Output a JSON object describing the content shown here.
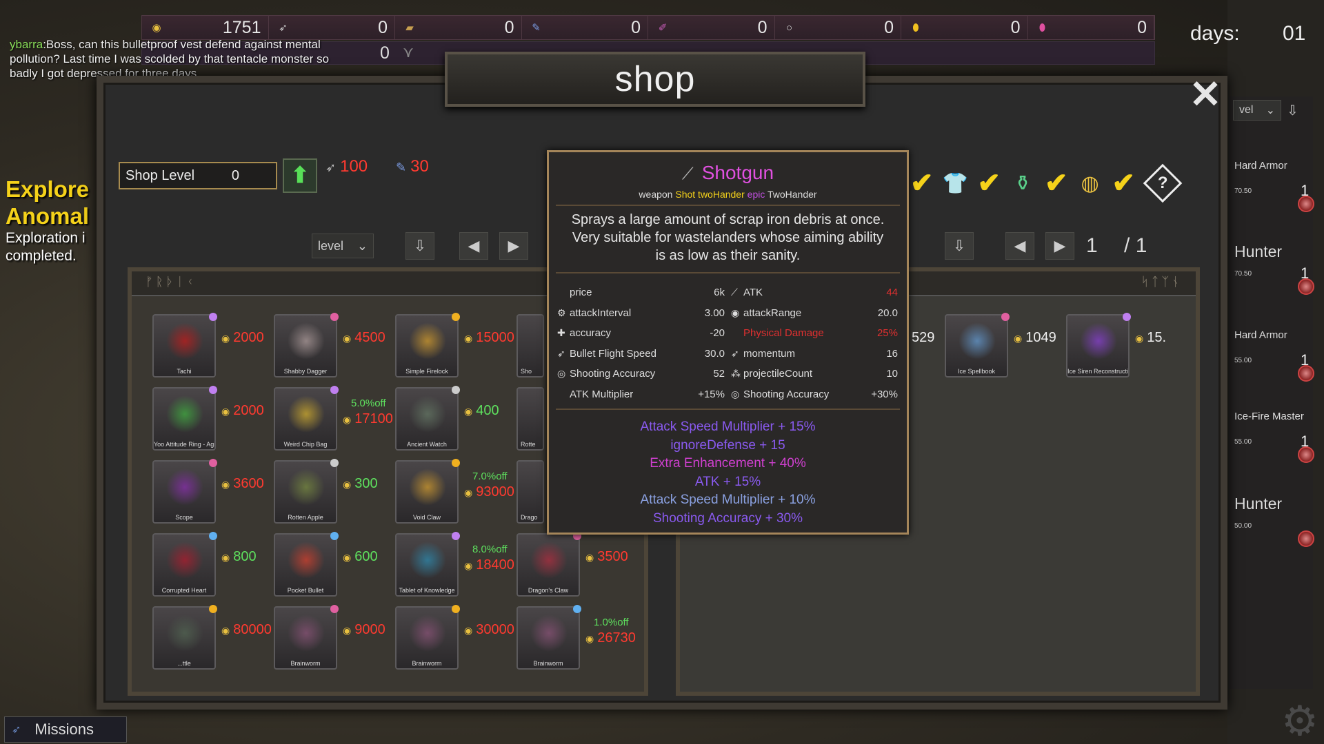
{
  "resources": [
    {
      "icon": "gold-coin-icon",
      "glyph": "◉",
      "color": "#e8c040",
      "value": "1751"
    },
    {
      "icon": "feather-icon",
      "glyph": "➶",
      "color": "#cccccc",
      "value": "0"
    },
    {
      "icon": "wood-icon",
      "glyph": "▰",
      "color": "#c8a050",
      "value": "0"
    },
    {
      "icon": "quill-icon",
      "glyph": "✎",
      "color": "#7a9ae0",
      "value": "0"
    },
    {
      "icon": "tentacle-icon",
      "glyph": "✐",
      "color": "#d060c0",
      "value": "0"
    },
    {
      "icon": "ring-icon",
      "glyph": "○",
      "color": "#dddddd",
      "value": "0"
    },
    {
      "icon": "amber-icon",
      "glyph": "⬮",
      "color": "#f0c020",
      "value": "0"
    },
    {
      "icon": "pink-gem-icon",
      "glyph": "⬮",
      "color": "#e050a0",
      "value": "0"
    }
  ],
  "resource_row2": {
    "value": "0"
  },
  "days": {
    "label": "days:",
    "value": "01"
  },
  "chat": {
    "speaker": "ybarra",
    "message": "Boss, can this bulletproof vest defend against mental pollution? Last time I was scolded by that tentacle monster so badly I got depressed for three days."
  },
  "quest": {
    "title_line1": "Explore",
    "title_line2": "Anomal",
    "desc_line1": "Exploration i",
    "desc_line2": "completed."
  },
  "shop": {
    "title": "shop",
    "level_label": "Shop Level",
    "level_value": "0",
    "cost1": "100",
    "cost2": "30",
    "sort_left": "level",
    "sort_right": "level",
    "page_current": "1",
    "page_total": "/ 1",
    "left_runes": "ᚠᚱᚦᛁᚲ",
    "right_runes": "ᛋᛏᛉᚾ"
  },
  "items": [
    {
      "name": "Tachi",
      "price": "2000",
      "price_color": "red",
      "discount": "",
      "art": "#b02020",
      "gem": "#c080f0"
    },
    {
      "name": "Shabby Dagger",
      "price": "4500",
      "price_color": "red",
      "discount": "",
      "art": "#a09090",
      "gem": "#e060a0"
    },
    {
      "name": "Simple Firelock",
      "price": "15000",
      "price_color": "red",
      "discount": "",
      "art": "#c09030",
      "gem": "#f0b020"
    },
    {
      "name": "Yoo Attitude Ring - Agility",
      "price": "2000",
      "price_color": "red",
      "discount": "",
      "art": "#40a040",
      "gem": "#c080f0"
    },
    {
      "name": "Weird Chip Bag",
      "price": "17100",
      "price_color": "red",
      "discount": "5.0%off",
      "art": "#c0a030",
      "gem": "#c080f0"
    },
    {
      "name": "Ancient Watch",
      "price": "400",
      "price_color": "green",
      "discount": "",
      "art": "#607060",
      "gem": "#cccccc"
    },
    {
      "name": "Scope",
      "price": "3600",
      "price_color": "red",
      "discount": "",
      "art": "#8030a0",
      "gem": "#e060a0"
    },
    {
      "name": "Rotten Apple",
      "price": "300",
      "price_color": "green",
      "discount": "",
      "art": "#708040",
      "gem": "#cccccc"
    },
    {
      "name": "Void Claw",
      "price": "93000",
      "price_color": "red",
      "discount": "7.0%off",
      "art": "#c09030",
      "gem": "#f0b020"
    },
    {
      "name": "Corrupted Heart",
      "price": "800",
      "price_color": "green",
      "discount": "",
      "art": "#a02030",
      "gem": "#60b0f0"
    },
    {
      "name": "Pocket Bullet",
      "price": "600",
      "price_color": "green",
      "discount": "",
      "art": "#c04030",
      "gem": "#60b0f0"
    },
    {
      "name": "Tablet of Knowledge",
      "price": "18400",
      "price_color": "red",
      "discount": "8.0%off",
      "art": "#3080a0",
      "gem": "#c080f0"
    },
    {
      "name": "Dragon's Claw",
      "price": "3500",
      "price_color": "red",
      "discount": "",
      "art": "#a03040",
      "gem": "#e060a0"
    },
    {
      "name": "...ttle",
      "price": "80000",
      "price_color": "red",
      "discount": "",
      "art": "#506050",
      "gem": "#f0b020"
    },
    {
      "name": "Brainworm",
      "price": "9000",
      "price_color": "red",
      "discount": "",
      "art": "#805070",
      "gem": "#e060a0"
    },
    {
      "name": "Brainworm",
      "price": "30000",
      "price_color": "red",
      "discount": "",
      "art": "#805070",
      "gem": "#f0b020"
    },
    {
      "name": "Brainworm",
      "price": "26730",
      "price_color": "red",
      "discount": "1.0%off",
      "art": "#805070",
      "gem": "#60b0f0"
    }
  ],
  "partial_items": [
    {
      "name": "Sho",
      "art": "#607090"
    },
    {
      "name": "Rotte",
      "art": "#806050"
    },
    {
      "name": "Drago",
      "art": "#a04040"
    }
  ],
  "right_items": [
    {
      "name": "Ice Spellbook",
      "price": "1049",
      "art": "#6090c0",
      "gem": "#e060a0"
    },
    {
      "name": "Ice Siren Reconstruction Potion",
      "price": "15.",
      "art": "#8040c0",
      "gem": "#c080f0"
    }
  ],
  "right_partial_price": "529",
  "tooltip": {
    "name": "Shotgun",
    "sub_prefix": "weapon",
    "sub_shot": "Shot twoHander",
    "sub_epic": "epic",
    "sub_type": "TwoHander",
    "description": "Sprays a large amount of scrap iron debris at once. Very suitable for wastelanders whose aiming ability is as low as their sanity.",
    "stats_left": [
      {
        "label": "price",
        "value": "6k",
        "icon": ""
      },
      {
        "label": "attackInterval",
        "value": "3.00",
        "icon": "⚙"
      },
      {
        "label": "accuracy",
        "value": "-20",
        "icon": "✚"
      },
      {
        "label": "Bullet Flight Speed",
        "value": "30.0",
        "icon": "➶"
      },
      {
        "label": "Shooting Accuracy",
        "value": "52",
        "icon": "◎"
      },
      {
        "label": "ATK Multiplier",
        "value": "+15%",
        "icon": ""
      }
    ],
    "stats_right": [
      {
        "label": "ATK",
        "value": "44",
        "icon": "⟋",
        "red": true
      },
      {
        "label": "attackRange",
        "value": "20.0",
        "icon": "◉",
        "red": false
      },
      {
        "label": "Physical Damage",
        "value": "25%",
        "icon": "",
        "red": true
      },
      {
        "label": "momentum",
        "value": "16",
        "icon": "➶",
        "red": false
      },
      {
        "label": "projectileCount",
        "value": "10",
        "icon": "⁂",
        "red": false
      },
      {
        "label": "Shooting Accuracy",
        "value": "+30%",
        "icon": "◎",
        "red": false
      }
    ],
    "bonuses": [
      {
        "text": "Attack Speed Multiplier + 15%",
        "color": "#8a5af0"
      },
      {
        "text": "ignoreDefense + 15",
        "color": "#8a5af0"
      },
      {
        "text": "Extra Enhancement + 40%",
        "color": "#d040d0"
      },
      {
        "text": "ATK + 15%",
        "color": "#8a5af0"
      },
      {
        "text": "Attack Speed Multiplier + 10%",
        "color": "#8aa0e0"
      },
      {
        "text": "Shooting Accuracy + 30%",
        "color": "#8a5af0"
      }
    ]
  },
  "characters": [
    {
      "name": "Hard Armor",
      "big": false,
      "num": "70.50",
      "level": "1"
    },
    {
      "name": "Hunter",
      "big": true,
      "num": "70.50",
      "level": "1"
    },
    {
      "name": "Hard Armor",
      "big": false,
      "num": "55.00",
      "level": "1"
    },
    {
      "name": "Ice-Fire Master",
      "big": false,
      "num": "55.00",
      "level": "1"
    },
    {
      "name": "Hunter",
      "big": true,
      "num": "50.00",
      "level": ""
    }
  ],
  "right_sort_label": "vel",
  "missions": {
    "label": "Missions"
  }
}
